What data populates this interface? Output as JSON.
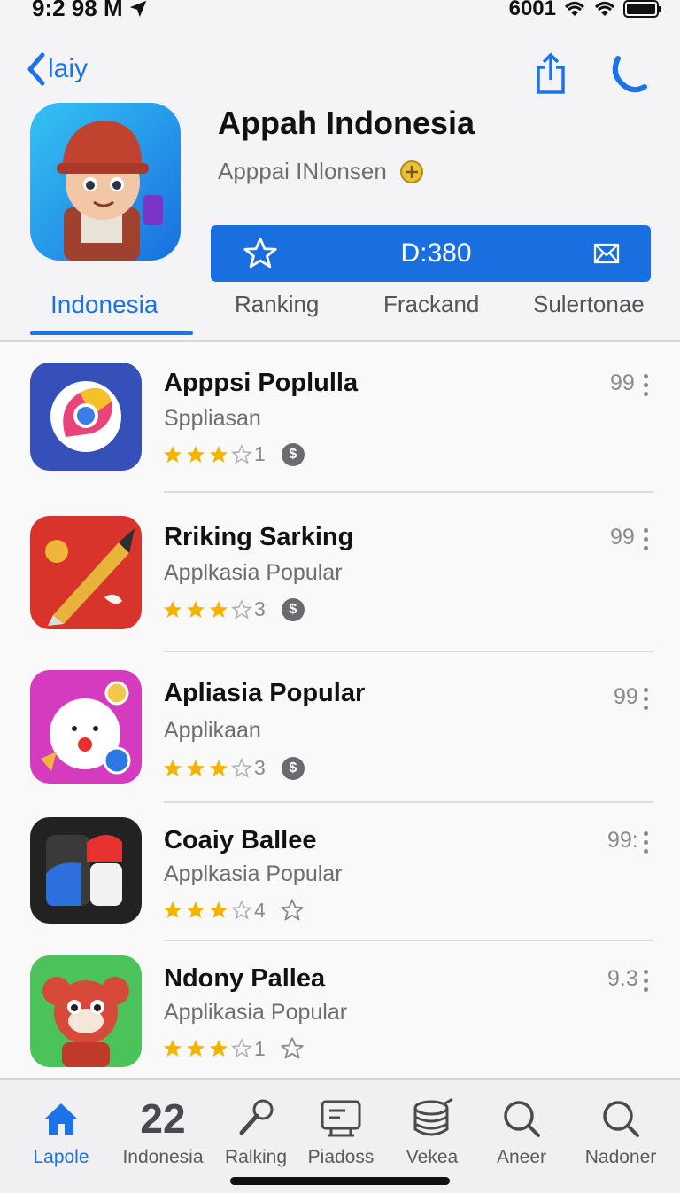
{
  "status": {
    "time": "9:2 98 M",
    "carrier": "6001"
  },
  "nav": {
    "back_label": "laiy"
  },
  "header": {
    "title": "Appah Indonesia",
    "subtitle": "Apppai INlonsen",
    "action_center": "D:380"
  },
  "tabs": [
    "Indonesia",
    "Ranking",
    "Frackand",
    "Sulertonae"
  ],
  "apps": [
    {
      "title": "Apppsi Poplulla",
      "category": "Sppliasan",
      "rating_text": "1",
      "score": "99"
    },
    {
      "title": "Rriking Sarking",
      "category": "Applkasia Popular",
      "rating_text": "3",
      "score": "99"
    },
    {
      "title": "Apliasia Popular",
      "category": "Applikaan",
      "rating_text": "3",
      "score": "99"
    },
    {
      "title": "Coaiy Ballee",
      "category": "Applkasia Popular",
      "rating_text": "4",
      "score": "99:"
    },
    {
      "title": "Ndony Pallea",
      "category": "Applikasia Popular",
      "rating_text": "1",
      "score": "9.3"
    }
  ],
  "tabbar": [
    {
      "label": "Lapole",
      "icon": "home-icon"
    },
    {
      "label": "Indonesia",
      "icon": "number-22",
      "glyph": "22"
    },
    {
      "label": "Ralking",
      "icon": "microphone-icon"
    },
    {
      "label": "Piadoss",
      "icon": "board-icon"
    },
    {
      "label": "Vekea",
      "icon": "stack-icon"
    },
    {
      "label": "Aneer",
      "icon": "search-icon"
    },
    {
      "label": "Nadoner",
      "icon": "search-icon"
    }
  ],
  "colors": {
    "accent": "#1a73e8",
    "star": "#f5b301"
  }
}
